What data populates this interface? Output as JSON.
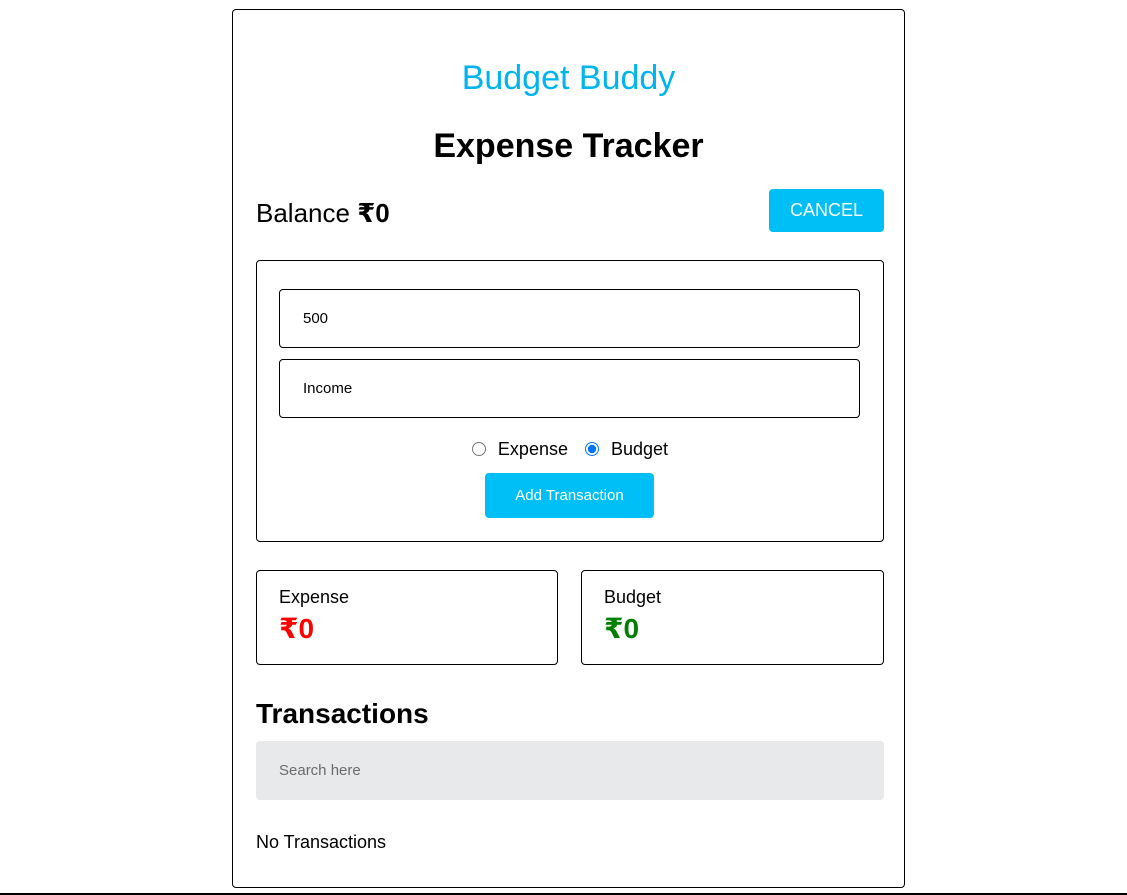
{
  "brand": "Budget Buddy",
  "title": "Expense Tracker",
  "balance": {
    "label": "Balance",
    "amount": "₹0"
  },
  "cancel_label": "CANCEL",
  "form": {
    "amount_value": "500",
    "description_value": "Income",
    "radio_options": [
      {
        "label": "Expense",
        "checked": false
      },
      {
        "label": "Budget",
        "checked": true
      }
    ],
    "submit_label": "Add Transaction"
  },
  "stats": {
    "expense": {
      "label": "Expense",
      "value": "₹0",
      "color": "#ff0000"
    },
    "budget": {
      "label": "Budget",
      "value": "₹0",
      "color": "#008000"
    }
  },
  "transactions": {
    "heading": "Transactions",
    "search_placeholder": "Search here",
    "empty_text": "No Transactions"
  },
  "colors": {
    "accent": "#00bff7",
    "brand": "#00b4ef"
  }
}
